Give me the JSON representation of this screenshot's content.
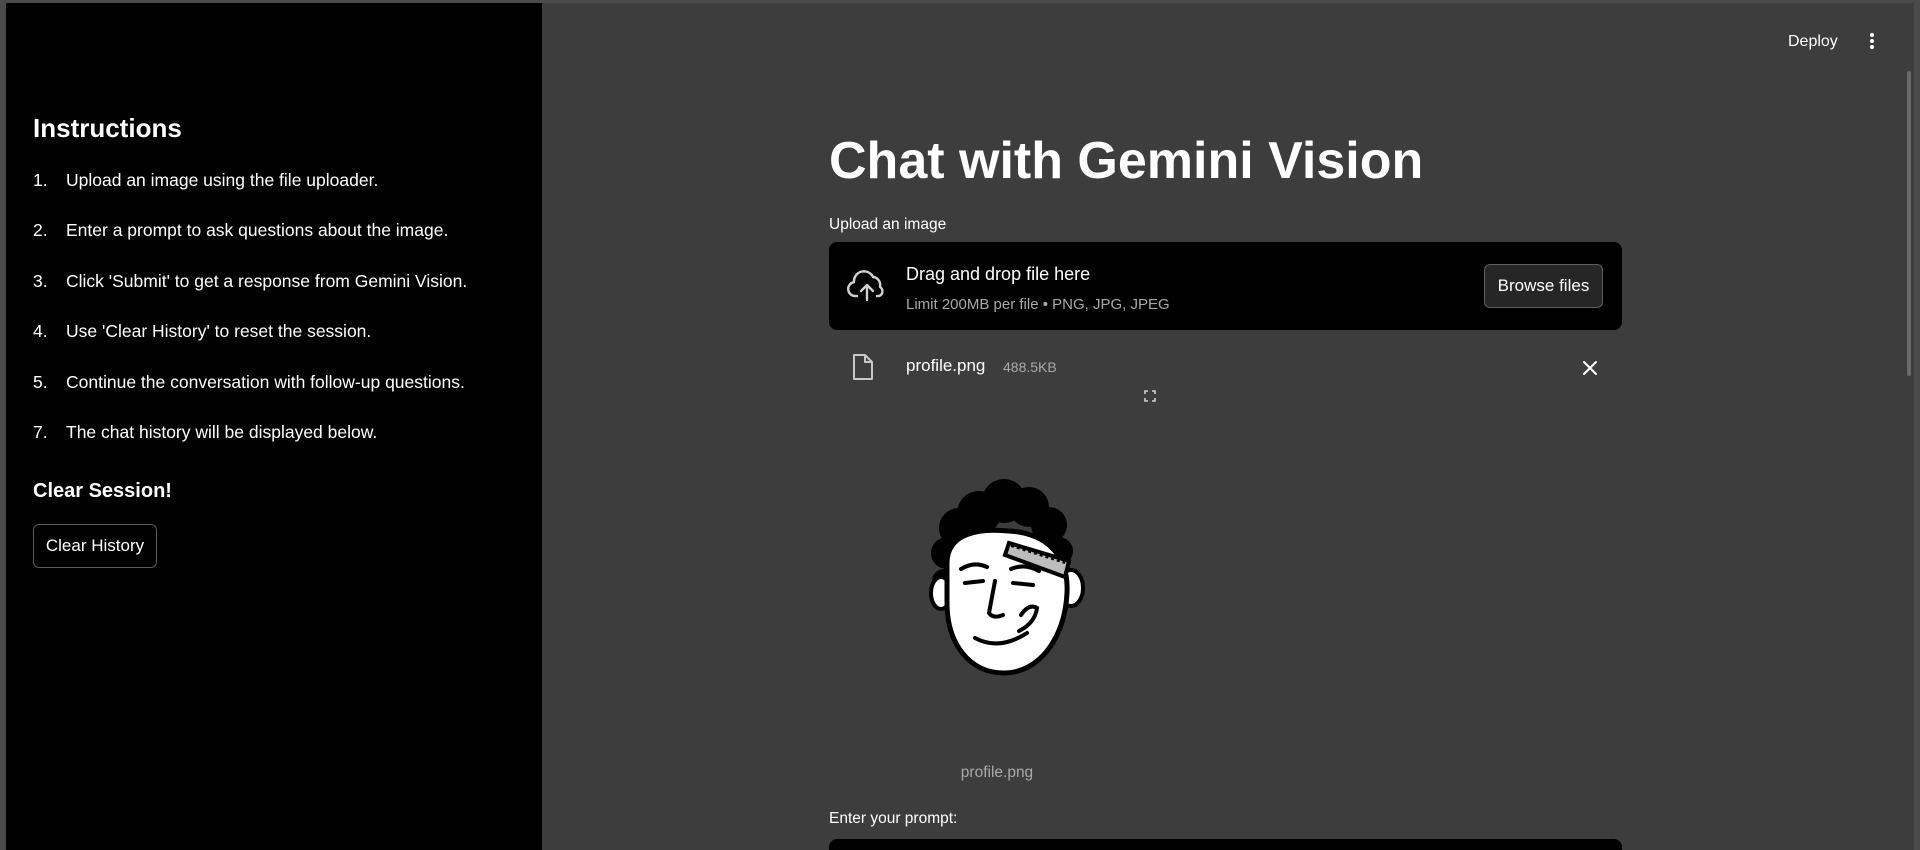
{
  "sidebar": {
    "title": "Instructions",
    "items": [
      {
        "num": "1.",
        "text": "Upload an image using the file uploader."
      },
      {
        "num": "2.",
        "text": "Enter a prompt to ask questions about the image."
      },
      {
        "num": "3.",
        "text": "Click 'Submit' to get a response from Gemini Vision."
      },
      {
        "num": "4.",
        "text": "Use 'Clear History' to reset the session."
      },
      {
        "num": "5.",
        "text": "Continue the conversation with follow-up questions."
      },
      {
        "num": "7.",
        "text": "The chat history will be displayed below."
      }
    ],
    "section_title": "Clear Session!",
    "clear_button": "Clear History"
  },
  "header": {
    "deploy_label": "Deploy",
    "menu_icon": "kebab-menu-icon"
  },
  "main": {
    "title": "Chat with Gemini Vision",
    "uploader": {
      "label": "Upload an image",
      "drop_text": "Drag and drop file here",
      "limit_text": "Limit 200MB per file • PNG, JPG, JPEG",
      "browse_label": "Browse files",
      "icon": "cloud-upload-icon"
    },
    "file": {
      "name": "profile.png",
      "size": "488.5KB",
      "icon": "file-icon",
      "remove_icon": "close-icon"
    },
    "image": {
      "caption": "profile.png",
      "fullscreen_icon": "fullscreen-icon"
    },
    "prompt": {
      "label": "Enter your prompt:",
      "value": ""
    }
  }
}
